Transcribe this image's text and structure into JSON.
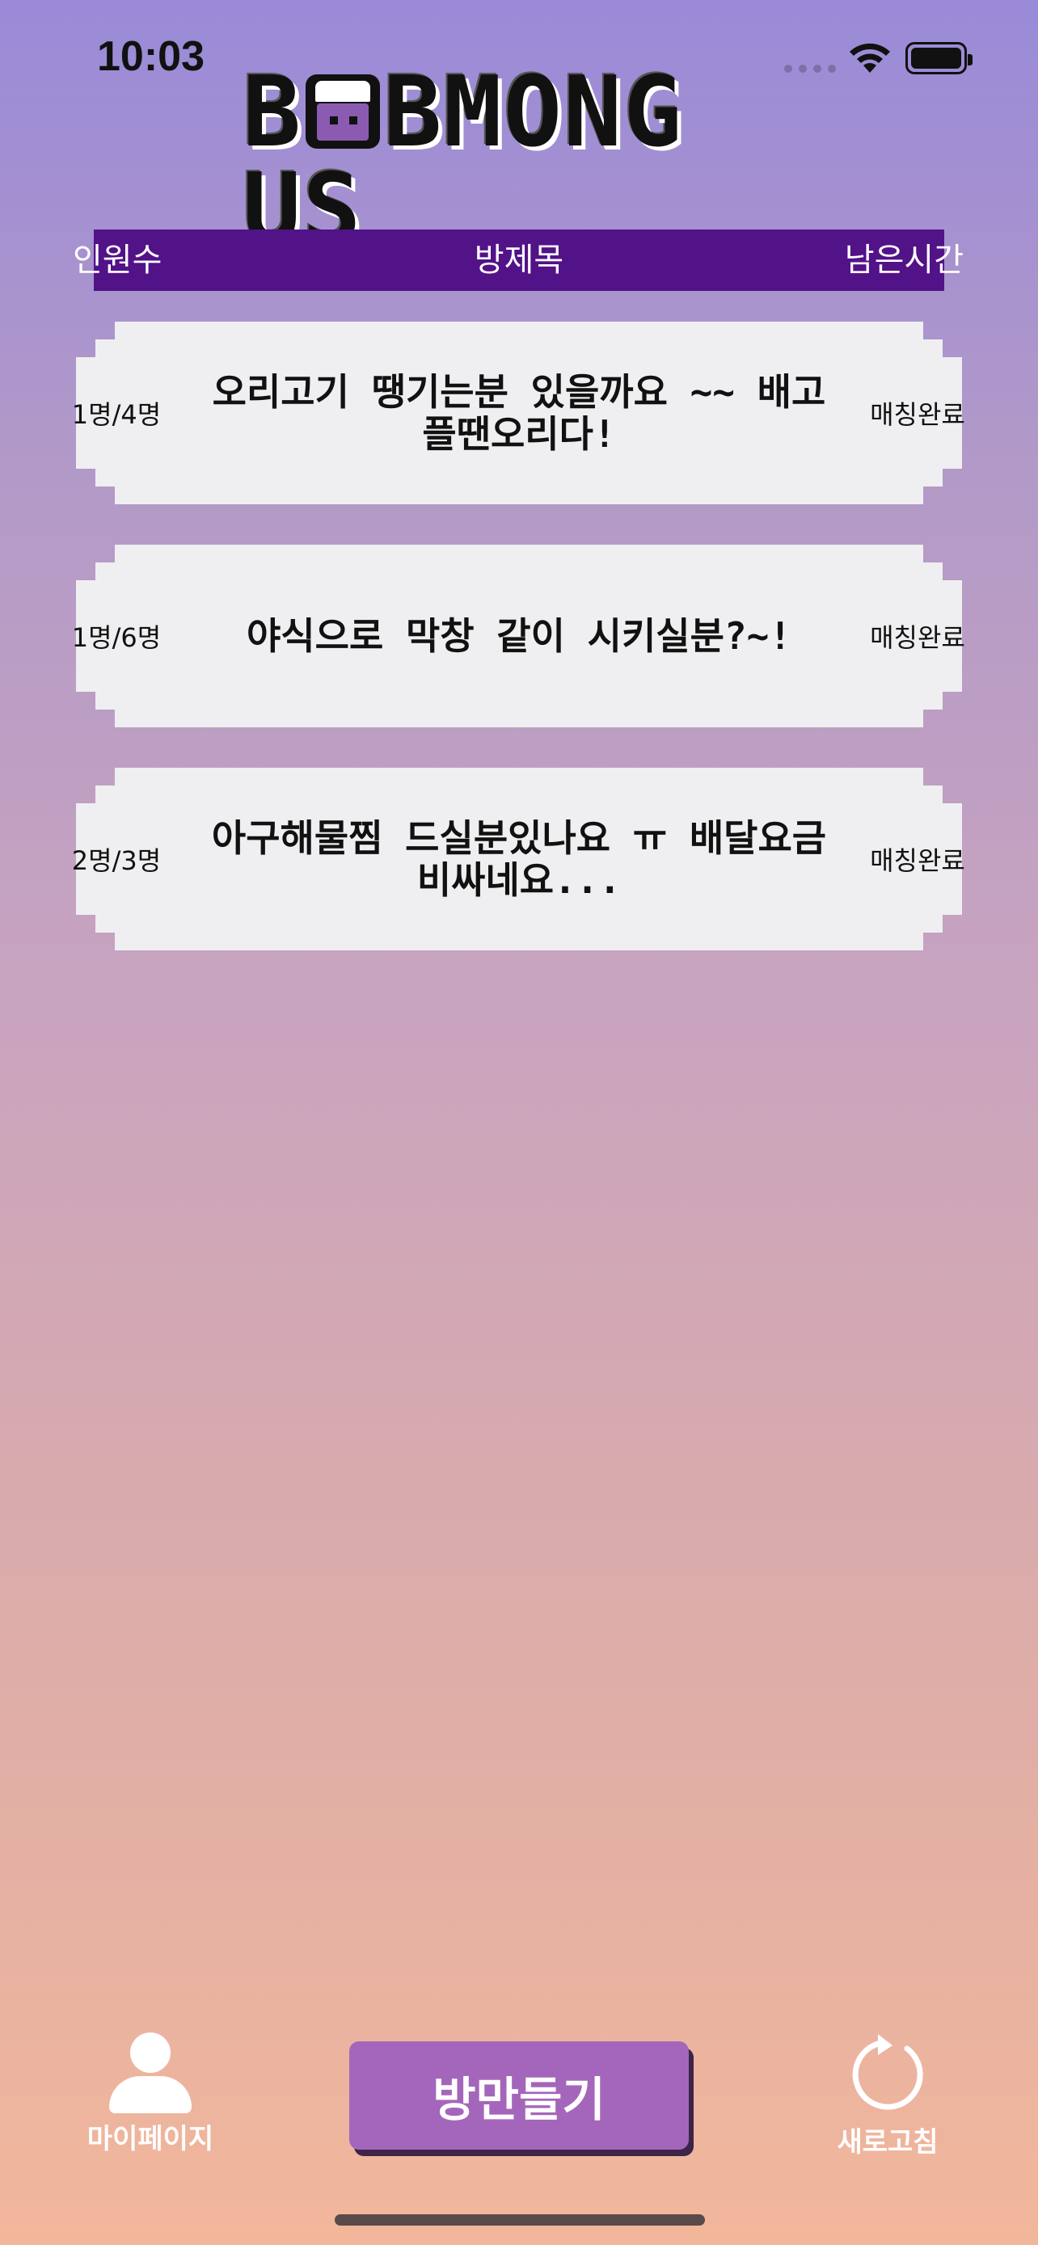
{
  "status_bar": {
    "time": "10:03"
  },
  "logo": {
    "text_before": "B",
    "text_after": "BMONG US"
  },
  "header": {
    "count_label": "인원수",
    "title_label": "방제목",
    "time_label": "남은시간",
    "bar_color": "#521288"
  },
  "rooms": [
    {
      "count": "1명/4명",
      "title": "오리고기 땡기는분 있을까요 ~~ 배고플땐오리다!",
      "status": "매칭완료"
    },
    {
      "count": "1명/6명",
      "title": "야식으로 막창 같이 시키실분?~!",
      "status": "매칭완료"
    },
    {
      "count": "2명/3명",
      "title": "아구해물찜 드실분있나요 ㅠ 배달요금 비싸네요...",
      "status": "매칭완료"
    }
  ],
  "bottom_bar": {
    "mypage_label": "마이페이지",
    "make_room_label": "방만들기",
    "refresh_label": "새로고침",
    "button_color": "#a466bb"
  },
  "icons": {
    "wifi": "wifi-icon",
    "battery": "battery-icon",
    "mypage": "person-icon",
    "refresh": "refresh-icon"
  }
}
